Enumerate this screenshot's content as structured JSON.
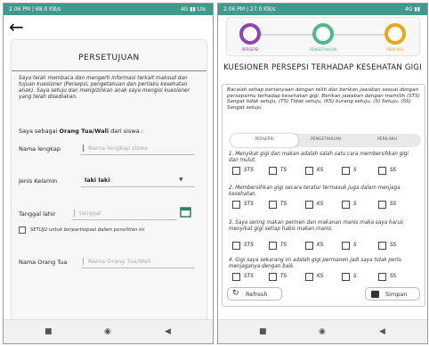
{
  "screen1": {
    "status_time": "2.06 PM | 68.0 KB/s",
    "status_right": "4G ▮▮ Lte",
    "title": "PERSETUJUAN",
    "intro": "Saya telah membaca dan mengerti informasi terkait maksud dan tujuan kuesioner (Persepsi, pengetahuan dan perilaku kesehatan anak). Saya setuju dan mengizinkan anak saya mengisi kuesioner yang telah disediakan.",
    "as_prefix": "Saya sebagai",
    "as_role": "Orang Tua/Wali",
    "as_suffix": "dari siswa :",
    "name_label": "Nama lengkap",
    "name_placeholder": "Nama lengkap siswa",
    "gender_label": "Jenis Kelamin",
    "gender_value": "laki laki",
    "dob_label": "Tanggal lahir",
    "dob_placeholder": "tanggal",
    "consent_label": "SETUJU untuk berpartisipasi dalam penelitian ini",
    "parent_label": "Nama Orang Tua",
    "parent_placeholder": "Nama Orang Tua/Wali"
  },
  "screen2": {
    "status_time": "2.06 PM | 27.0 KB/s",
    "status_right": "4G ▮▮",
    "steps": [
      {
        "label": "PERSEPSI",
        "color": "#8e44ad"
      },
      {
        "label": "PENGETAHUAN",
        "color": "#52b788"
      },
      {
        "label": "PERILAKU",
        "color": "#e6a817"
      }
    ],
    "title": "KUESIONER PERSEPSI TERHADAP KESEHATAN GIGI",
    "instructions": "Bacalah setiap pertanyaan dengan teliti dan berikan jawaban sesuai dengan persepsimu terhadap kesehatan gigi. Berikan jawaban dengan memilih (STS) Sangat tidak setuju, (TS) Tidak setuju, (KS) kurang setuju, (S) Setuju, (SS) Sangat setuju",
    "tabs": [
      "PERSEPSI",
      "PENGETAHUAN",
      "PERILAKU"
    ],
    "options": [
      "STS",
      "TS",
      "KS",
      "S",
      "SS"
    ],
    "questions": [
      "1. Menyikat gigi dan makan adalah salah satu cara membersihkan gigi dan mulut.",
      "2. Membersihkan gigi secara teratur termasuk juga dalam menjaga kesehatan.",
      "3. Saya sering makan permen dan makanan manis maka saya harus menyikat gigi setiap habis makan manis.",
      "4. Gigi saya sekarang ini adalah gigi permanen jadi saya tidak perlu menjaganya dengan baik."
    ],
    "refresh_label": "Refresh",
    "save_label": "Simpan"
  }
}
